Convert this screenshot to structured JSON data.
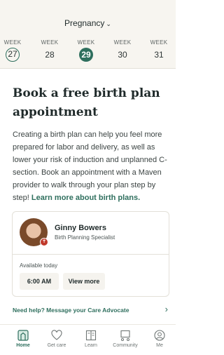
{
  "header": {
    "title": "Pregnancy",
    "dropdown_icon": "chevron-down-icon"
  },
  "weeks": [
    {
      "label": "WEEK",
      "number": "27",
      "state": "previous"
    },
    {
      "label": "WEEK",
      "number": "28",
      "state": "default"
    },
    {
      "label": "WEEK",
      "number": "29",
      "state": "current"
    },
    {
      "label": "WEEK",
      "number": "30",
      "state": "default"
    },
    {
      "label": "WEEK",
      "number": "31",
      "state": "default"
    }
  ],
  "article": {
    "title": "Book a free birth plan appointment",
    "body": "Creating a birth plan can help you feel more prepared for labor and delivery, as well as lower your risk of induction and unplanned C-section. Book an appointment with a Maven provider to walk through your plan step by step!",
    "link": "Learn more about birth plans."
  },
  "provider_card": {
    "name": "Ginny Bowers",
    "role": "Birth Planning Specialist",
    "availability": "Available today",
    "slot": "6:00 AM",
    "more": "View more"
  },
  "help": {
    "text": "Need help? Message your Care Advocate",
    "icon": "chevron-right-icon"
  },
  "tabs": [
    {
      "label": "Home",
      "icon": "home-icon",
      "active": true
    },
    {
      "label": "Get care",
      "icon": "heart-hands-icon",
      "active": false
    },
    {
      "label": "Learn",
      "icon": "book-icon",
      "active": false
    },
    {
      "label": "Community",
      "icon": "community-icon",
      "active": false
    },
    {
      "label": "Me",
      "icon": "user-icon",
      "active": false
    }
  ],
  "colors": {
    "accent": "#2f6f5e",
    "header_bg": "#f7f5f0",
    "badge": "#c0392b"
  }
}
